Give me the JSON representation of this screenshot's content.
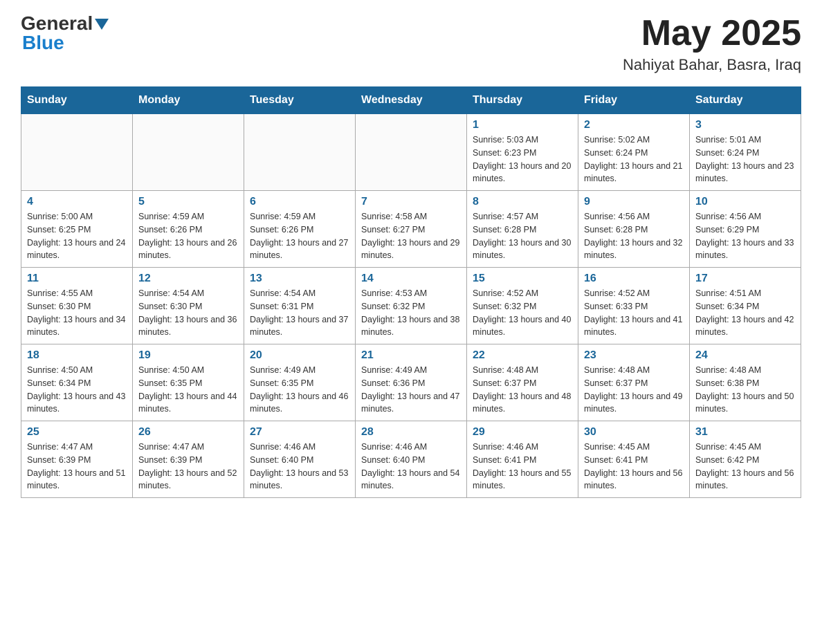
{
  "logo": {
    "general": "General",
    "blue": "Blue"
  },
  "header": {
    "month": "May 2025",
    "location": "Nahiyat Bahar, Basra, Iraq"
  },
  "weekdays": [
    "Sunday",
    "Monday",
    "Tuesday",
    "Wednesday",
    "Thursday",
    "Friday",
    "Saturday"
  ],
  "weeks": [
    [
      {
        "day": "",
        "info": ""
      },
      {
        "day": "",
        "info": ""
      },
      {
        "day": "",
        "info": ""
      },
      {
        "day": "",
        "info": ""
      },
      {
        "day": "1",
        "info": "Sunrise: 5:03 AM\nSunset: 6:23 PM\nDaylight: 13 hours and 20 minutes."
      },
      {
        "day": "2",
        "info": "Sunrise: 5:02 AM\nSunset: 6:24 PM\nDaylight: 13 hours and 21 minutes."
      },
      {
        "day": "3",
        "info": "Sunrise: 5:01 AM\nSunset: 6:24 PM\nDaylight: 13 hours and 23 minutes."
      }
    ],
    [
      {
        "day": "4",
        "info": "Sunrise: 5:00 AM\nSunset: 6:25 PM\nDaylight: 13 hours and 24 minutes."
      },
      {
        "day": "5",
        "info": "Sunrise: 4:59 AM\nSunset: 6:26 PM\nDaylight: 13 hours and 26 minutes."
      },
      {
        "day": "6",
        "info": "Sunrise: 4:59 AM\nSunset: 6:26 PM\nDaylight: 13 hours and 27 minutes."
      },
      {
        "day": "7",
        "info": "Sunrise: 4:58 AM\nSunset: 6:27 PM\nDaylight: 13 hours and 29 minutes."
      },
      {
        "day": "8",
        "info": "Sunrise: 4:57 AM\nSunset: 6:28 PM\nDaylight: 13 hours and 30 minutes."
      },
      {
        "day": "9",
        "info": "Sunrise: 4:56 AM\nSunset: 6:28 PM\nDaylight: 13 hours and 32 minutes."
      },
      {
        "day": "10",
        "info": "Sunrise: 4:56 AM\nSunset: 6:29 PM\nDaylight: 13 hours and 33 minutes."
      }
    ],
    [
      {
        "day": "11",
        "info": "Sunrise: 4:55 AM\nSunset: 6:30 PM\nDaylight: 13 hours and 34 minutes."
      },
      {
        "day": "12",
        "info": "Sunrise: 4:54 AM\nSunset: 6:30 PM\nDaylight: 13 hours and 36 minutes."
      },
      {
        "day": "13",
        "info": "Sunrise: 4:54 AM\nSunset: 6:31 PM\nDaylight: 13 hours and 37 minutes."
      },
      {
        "day": "14",
        "info": "Sunrise: 4:53 AM\nSunset: 6:32 PM\nDaylight: 13 hours and 38 minutes."
      },
      {
        "day": "15",
        "info": "Sunrise: 4:52 AM\nSunset: 6:32 PM\nDaylight: 13 hours and 40 minutes."
      },
      {
        "day": "16",
        "info": "Sunrise: 4:52 AM\nSunset: 6:33 PM\nDaylight: 13 hours and 41 minutes."
      },
      {
        "day": "17",
        "info": "Sunrise: 4:51 AM\nSunset: 6:34 PM\nDaylight: 13 hours and 42 minutes."
      }
    ],
    [
      {
        "day": "18",
        "info": "Sunrise: 4:50 AM\nSunset: 6:34 PM\nDaylight: 13 hours and 43 minutes."
      },
      {
        "day": "19",
        "info": "Sunrise: 4:50 AM\nSunset: 6:35 PM\nDaylight: 13 hours and 44 minutes."
      },
      {
        "day": "20",
        "info": "Sunrise: 4:49 AM\nSunset: 6:35 PM\nDaylight: 13 hours and 46 minutes."
      },
      {
        "day": "21",
        "info": "Sunrise: 4:49 AM\nSunset: 6:36 PM\nDaylight: 13 hours and 47 minutes."
      },
      {
        "day": "22",
        "info": "Sunrise: 4:48 AM\nSunset: 6:37 PM\nDaylight: 13 hours and 48 minutes."
      },
      {
        "day": "23",
        "info": "Sunrise: 4:48 AM\nSunset: 6:37 PM\nDaylight: 13 hours and 49 minutes."
      },
      {
        "day": "24",
        "info": "Sunrise: 4:48 AM\nSunset: 6:38 PM\nDaylight: 13 hours and 50 minutes."
      }
    ],
    [
      {
        "day": "25",
        "info": "Sunrise: 4:47 AM\nSunset: 6:39 PM\nDaylight: 13 hours and 51 minutes."
      },
      {
        "day": "26",
        "info": "Sunrise: 4:47 AM\nSunset: 6:39 PM\nDaylight: 13 hours and 52 minutes."
      },
      {
        "day": "27",
        "info": "Sunrise: 4:46 AM\nSunset: 6:40 PM\nDaylight: 13 hours and 53 minutes."
      },
      {
        "day": "28",
        "info": "Sunrise: 4:46 AM\nSunset: 6:40 PM\nDaylight: 13 hours and 54 minutes."
      },
      {
        "day": "29",
        "info": "Sunrise: 4:46 AM\nSunset: 6:41 PM\nDaylight: 13 hours and 55 minutes."
      },
      {
        "day": "30",
        "info": "Sunrise: 4:45 AM\nSunset: 6:41 PM\nDaylight: 13 hours and 56 minutes."
      },
      {
        "day": "31",
        "info": "Sunrise: 4:45 AM\nSunset: 6:42 PM\nDaylight: 13 hours and 56 minutes."
      }
    ]
  ]
}
